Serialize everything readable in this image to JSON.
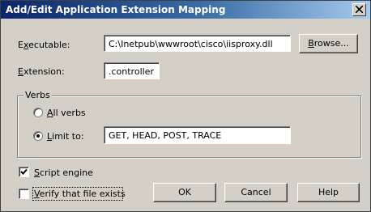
{
  "window": {
    "title": "Add/Edit Application Extension Mapping"
  },
  "executable": {
    "label_key": "x",
    "label_prefix": "E",
    "label_suffix": "ecutable:",
    "value": "C:\\Inetpub\\wwwroot\\cisco\\iisproxy.dll",
    "browse_key": "B",
    "browse_rest": "rowse..."
  },
  "extension": {
    "label_key": "E",
    "label_rest": "xtension:",
    "value": ".controller"
  },
  "verbs": {
    "group_label": "Verbs",
    "all_key": "A",
    "all_rest": "ll verbs",
    "limit_key": "L",
    "limit_rest": "imit to:",
    "limit_value": "GET, HEAD, POST, TRACE",
    "selected": "limit"
  },
  "options": {
    "script_key": "S",
    "script_rest": "cript engine",
    "script_checked": true,
    "verify_key": "V",
    "verify_rest": "erify that file exists",
    "verify_checked": false
  },
  "buttons": {
    "ok": "OK",
    "cancel": "Cancel",
    "help": "Help"
  },
  "colors": {
    "title_start": "#0a246a",
    "title_end": "#a6caf0",
    "dialog_face": "#d4d0c8"
  }
}
